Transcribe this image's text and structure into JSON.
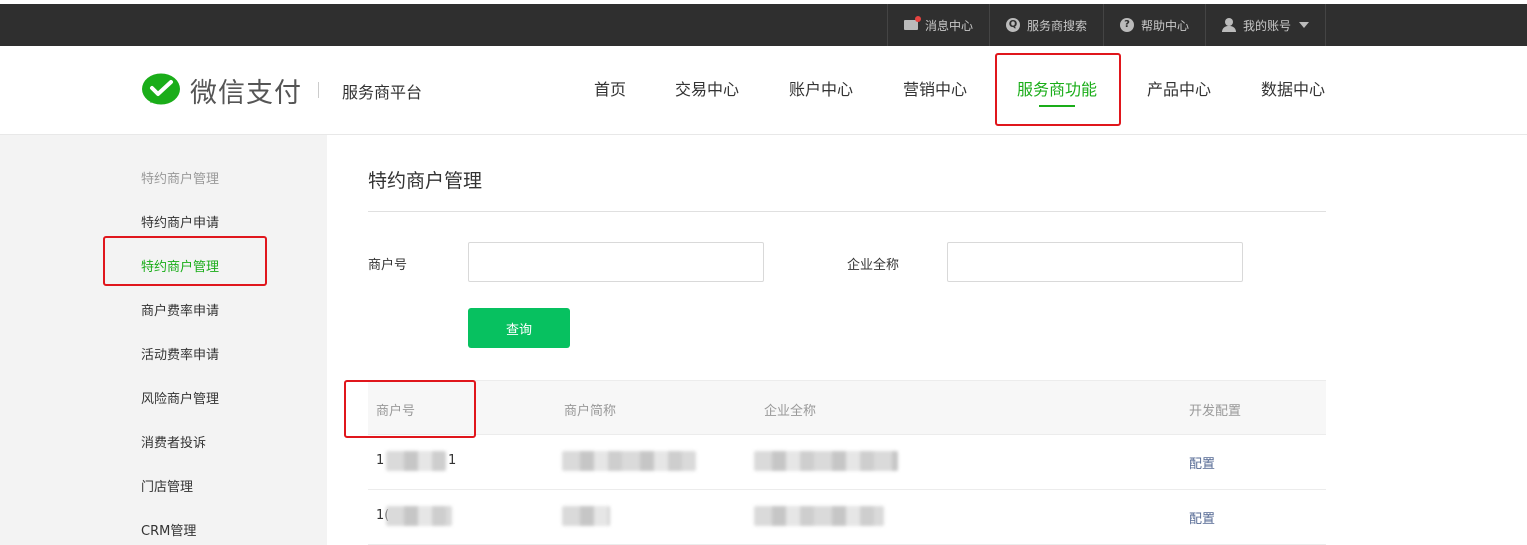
{
  "topbar": {
    "links": [
      {
        "label": "消息中心",
        "icon": "mail-icon"
      },
      {
        "label": "服务商搜索",
        "icon": "search-icon"
      },
      {
        "label": "帮助中心",
        "icon": "help-icon"
      },
      {
        "label": "我的账号",
        "icon": "user-icon"
      }
    ]
  },
  "brand": {
    "name": "微信支付",
    "platform": "服务商平台",
    "color": "#1aad19"
  },
  "nav": {
    "items": [
      "首页",
      "交易中心",
      "账户中心",
      "营销中心",
      "服务商功能",
      "产品中心",
      "数据中心"
    ],
    "active": "服务商功能"
  },
  "sidebar": {
    "title": "特约商户管理",
    "items": [
      "特约商户申请",
      "特约商户管理",
      "商户费率申请",
      "活动费率申请",
      "风险商户管理",
      "消费者投诉",
      "门店管理",
      "CRM管理"
    ],
    "active": "特约商户管理"
  },
  "main": {
    "title": "特约商户管理",
    "form": {
      "merchant_id_label": "商户号",
      "company_name_label": "企业全称",
      "merchant_id_value": "",
      "company_name_value": "",
      "query_label": "查询"
    },
    "table": {
      "headers": [
        "商户号",
        "商户简称",
        "企业全称",
        "开发配置"
      ],
      "rows": [
        {
          "merchant_id_visible": "1",
          "merchant_id_tail": "1",
          "action": "配置"
        },
        {
          "merchant_id_visible": "1(",
          "merchant_id_tail": "",
          "action": "配置"
        }
      ]
    }
  },
  "colors": {
    "topbar": "#2f2f2f",
    "accent": "#1aad19",
    "button": "#07c160",
    "link": "#576b95",
    "annotation": "#e0161c"
  }
}
